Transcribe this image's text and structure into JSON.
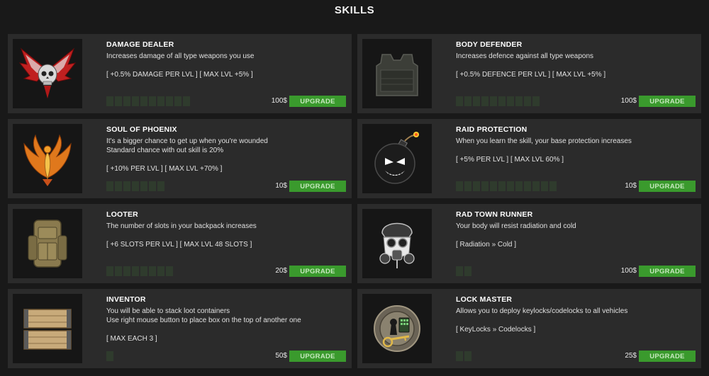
{
  "header": {
    "title": "SKILLS"
  },
  "upgrade_label": "UPGRADE",
  "skills": [
    {
      "name": "DAMAGE DEALER",
      "desc1": "Increases damage of all type weapons you use",
      "desc2": "",
      "stats": "[ +0.5% DAMAGE PER LVL ] [ MAX LVL +5% ]",
      "price": "100$",
      "levels": 10,
      "icon": "winged-skull-icon"
    },
    {
      "name": "BODY DEFENDER",
      "desc1": "Increases defence against all type weapons",
      "desc2": "",
      "stats": "[ +0.5% DEFENCE PER LVL ] [ MAX LVL +5% ]",
      "price": "100$",
      "levels": 10,
      "icon": "armor-vest-icon"
    },
    {
      "name": "SOUL OF PHOENIX",
      "desc1": "It's a bigger chance to get up when you're wounded",
      "desc2": "Standard chance with out skill is 20%",
      "stats": "[ +10% PER LVL ] [ MAX LVL +70% ]",
      "price": "10$",
      "levels": 7,
      "icon": "phoenix-icon"
    },
    {
      "name": "RAID PROTECTION",
      "desc1": "When you learn the skill, your base protection increases",
      "desc2": "",
      "stats": "[ +5% PER LVL ] [ MAX LVL 60% ]",
      "price": "10$",
      "levels": 12,
      "icon": "bomb-icon"
    },
    {
      "name": "LOOTER",
      "desc1": "The number of slots in your backpack increases",
      "desc2": "",
      "stats": "[ +6 SLOTS PER LVL ] [ MAX LVL 48 SLOTS ]",
      "price": "20$",
      "levels": 8,
      "icon": "backpack-icon"
    },
    {
      "name": "RAD TOWN RUNNER",
      "desc1": "Your body will resist radiation and cold",
      "desc2": "",
      "stats": "[ Radiation » Cold ]",
      "price": "100$",
      "levels": 2,
      "icon": "gas-mask-skull-icon"
    },
    {
      "name": "INVENTOR",
      "desc1": "You will be able to stack loot containers",
      "desc2": "Use right mouse button to place box on the top of another one",
      "stats": "[ MAX EACH 3 ]",
      "price": "50$",
      "levels": 1,
      "icon": "wooden-crates-icon"
    },
    {
      "name": "LOCK MASTER",
      "desc1": "Allows you to deploy keylocks/codelocks to all vehicles",
      "desc2": "",
      "stats": "[ KeyLocks » Codelocks ]",
      "price": "25$",
      "levels": 2,
      "icon": "lock-key-icon"
    }
  ]
}
